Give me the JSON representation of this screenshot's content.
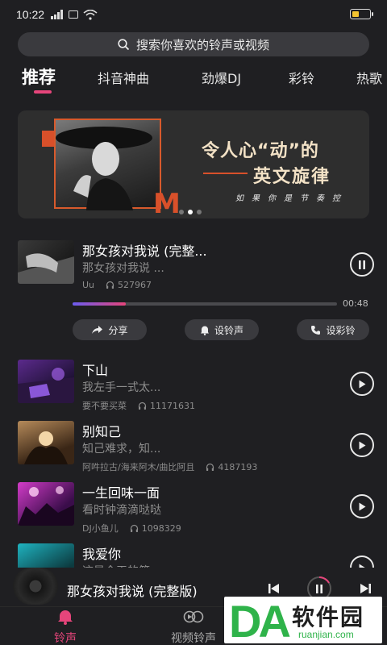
{
  "status_bar": {
    "time": "10:22"
  },
  "search": {
    "placeholder": "搜索你喜欢的铃声或视频"
  },
  "tabs": [
    {
      "label": "推荐"
    },
    {
      "label": "抖音神曲"
    },
    {
      "label": "劲爆DJ"
    },
    {
      "label": "彩铃"
    },
    {
      "label": "热歌"
    }
  ],
  "banner": {
    "line1": "令人心“动”的",
    "line2": "英文旋律",
    "line3": "如果你是节奏控",
    "letter": "M"
  },
  "current_song": {
    "title": "那女孩对我说 (完整...",
    "subtitle": "那女孩对我说 ...",
    "artist": "Uu",
    "plays": "527967",
    "duration": "00:48",
    "progress_fraction": 0.2
  },
  "actions": {
    "share": "分享",
    "set_ringtone": "设铃声",
    "set_crbt": "设彩铃"
  },
  "songs": [
    {
      "title": "下山",
      "subtitle": "我左手一式太...",
      "artist": "要不要买菜",
      "plays": "11171631"
    },
    {
      "title": "别知己",
      "subtitle": "知己难求，知...",
      "artist": "阿吽拉古/海来阿木/曲比阿且",
      "plays": "4187193"
    },
    {
      "title": "一生回味一面",
      "subtitle": "看时钟滴滴哒哒",
      "artist": "DJ小鱼儿",
      "plays": "1098329"
    },
    {
      "title": "我爱你",
      "subtitle": "这是今天的第..."
    }
  ],
  "mini_player": {
    "title": "那女孩对我说 (完整版)"
  },
  "bottom_nav": {
    "ringtone": "铃声",
    "video_ringtone": "视频铃声"
  },
  "watermark": {
    "text_latin": "DA",
    "text_cn": "软件园",
    "url": "ruanjian.com"
  },
  "colors": {
    "accent": "#e6457b",
    "background": "#1f1f22"
  }
}
